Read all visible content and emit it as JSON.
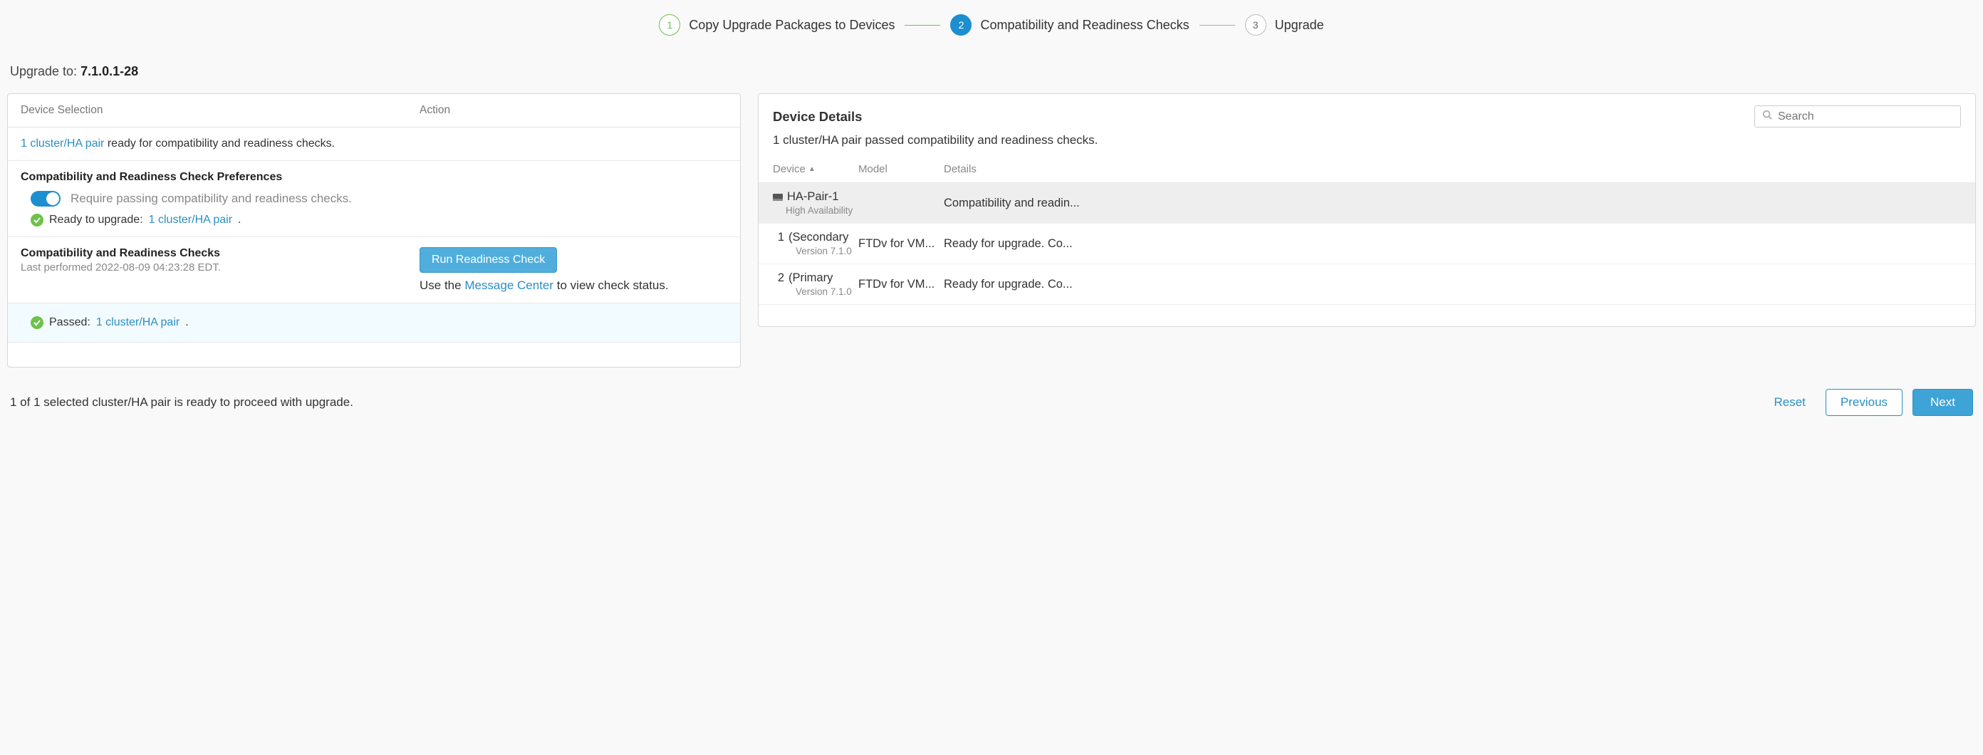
{
  "stepper": {
    "steps": [
      {
        "num": "1",
        "label": "Copy Upgrade Packages to Devices"
      },
      {
        "num": "2",
        "label": "Compatibility and Readiness Checks"
      },
      {
        "num": "3",
        "label": "Upgrade"
      }
    ]
  },
  "upgrade_to": {
    "prefix": "Upgrade to: ",
    "version": "7.1.0.1-28"
  },
  "left": {
    "headers": {
      "device": "Device Selection",
      "action": "Action"
    },
    "ready_line": {
      "link": "1 cluster/HA pair",
      "rest": " ready for compatibility and readiness checks."
    },
    "prefs": {
      "title": "Compatibility and Readiness Check Preferences",
      "toggle_label": "Require passing compatibility and readiness checks.",
      "ready_label": "Ready to upgrade: ",
      "ready_link": "1 cluster/HA pair",
      "ready_suffix": "."
    },
    "checks": {
      "title": "Compatibility and Readiness Checks",
      "last": "Last performed 2022-08-09 04:23:28 EDT.",
      "run_label": "Run Readiness Check",
      "msg_pre": "Use the ",
      "msg_link": "Message Center",
      "msg_post": " to view check status."
    },
    "passed": {
      "prefix": "Passed: ",
      "link": "1 cluster/HA pair",
      "suffix": "."
    }
  },
  "right": {
    "title": "Device Details",
    "search_placeholder": "Search",
    "summary": "1 cluster/HA pair passed compatibility and readiness checks.",
    "cols": {
      "device": "Device",
      "model": "Model",
      "details": "Details"
    },
    "group": {
      "name": "HA-Pair-1",
      "sub": "High Availability",
      "details": "Compatibility and readin..."
    },
    "rows": [
      {
        "num": "1",
        "role": "(Secondary",
        "ver": "Version 7.1.0",
        "model": "FTDv for VM...",
        "details": "Ready for upgrade. Co..."
      },
      {
        "num": "2",
        "role": "(Primary",
        "ver": "Version 7.1.0",
        "model": "FTDv for VM...",
        "details": "Ready for upgrade. Co..."
      }
    ]
  },
  "footer": {
    "status": "1 of 1 selected cluster/HA pair is ready to proceed with upgrade.",
    "reset": "Reset",
    "previous": "Previous",
    "next": "Next"
  }
}
